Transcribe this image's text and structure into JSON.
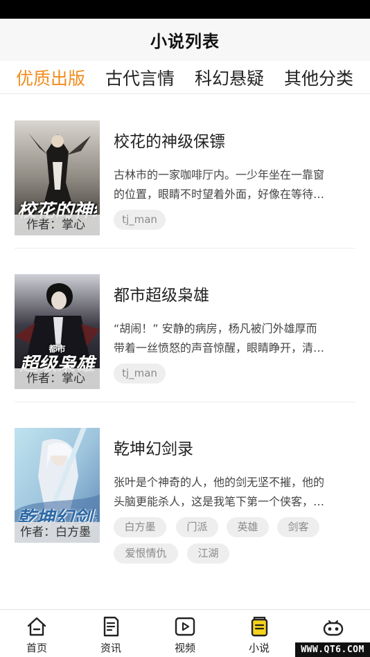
{
  "header": {
    "title": "小说列表"
  },
  "tabs": [
    {
      "label": "优质出版",
      "active": true
    },
    {
      "label": "古代言情",
      "active": false
    },
    {
      "label": "科幻悬疑",
      "active": false
    },
    {
      "label": "其他分类",
      "active": false
    }
  ],
  "books": [
    {
      "title": "校花的神级保镖",
      "summary_line1": "古林市的一家咖啡厅内。一少年坐在一靠窗",
      "summary_line2": "的位置，眼睛不时望着外面，好像在等待…",
      "cover_title": "校花的神级保镖",
      "cover_author": "作者：掌心",
      "tags": [
        "tj_man"
      ]
    },
    {
      "title": "都市超级枭雄",
      "summary_line1": "“胡闹！” 安静的病房，杨凡被门外雄厚而",
      "summary_line2": "带着一丝愤怒的声音惊醒，眼睛睁开，清…",
      "cover_title": "超级枭雄",
      "cover_subtitle": "都市",
      "cover_author": "作者：掌心",
      "tags": [
        "tj_man"
      ]
    },
    {
      "title": "乾坤幻剑录",
      "summary_line1": "张叶是个神奇的人，他的剑无坚不摧，他的",
      "summary_line2": "头脑更能杀人，这是我笔下第一个侠客，…",
      "cover_title": "乾坤幻剑录",
      "cover_author": "作者：白方墨",
      "tags": [
        "白方墨",
        "门派",
        "英雄",
        "剑客",
        "爱恨情仇",
        "江湖"
      ]
    }
  ],
  "nav": [
    {
      "label": "首页",
      "icon": "home-icon"
    },
    {
      "label": "资讯",
      "icon": "news-icon"
    },
    {
      "label": "视频",
      "icon": "video-icon"
    },
    {
      "label": "小说",
      "icon": "novel-icon",
      "active": true
    },
    {
      "label": "",
      "icon": "game-controller-icon"
    }
  ],
  "watermark": "WWW.QT6.COM",
  "colors": {
    "accent": "#f08c1c",
    "novel_icon_fill": "#f7d21c",
    "tag_bg": "#eeeeee"
  }
}
